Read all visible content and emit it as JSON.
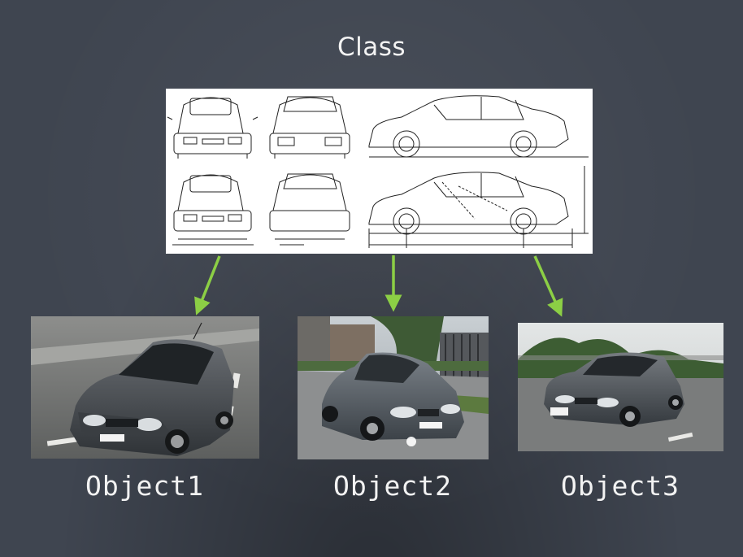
{
  "heading": "Class",
  "objects": [
    {
      "label": "Object1"
    },
    {
      "label": "Object2"
    },
    {
      "label": "Object3"
    }
  ],
  "colors": {
    "background": "#3f4550",
    "arrow": "#8ccf45",
    "text": "#f3f3f3",
    "car_body": "#4a4f55"
  },
  "icons": {
    "blueprint": "car-blueprint-drawing",
    "photo": "car-photo"
  }
}
